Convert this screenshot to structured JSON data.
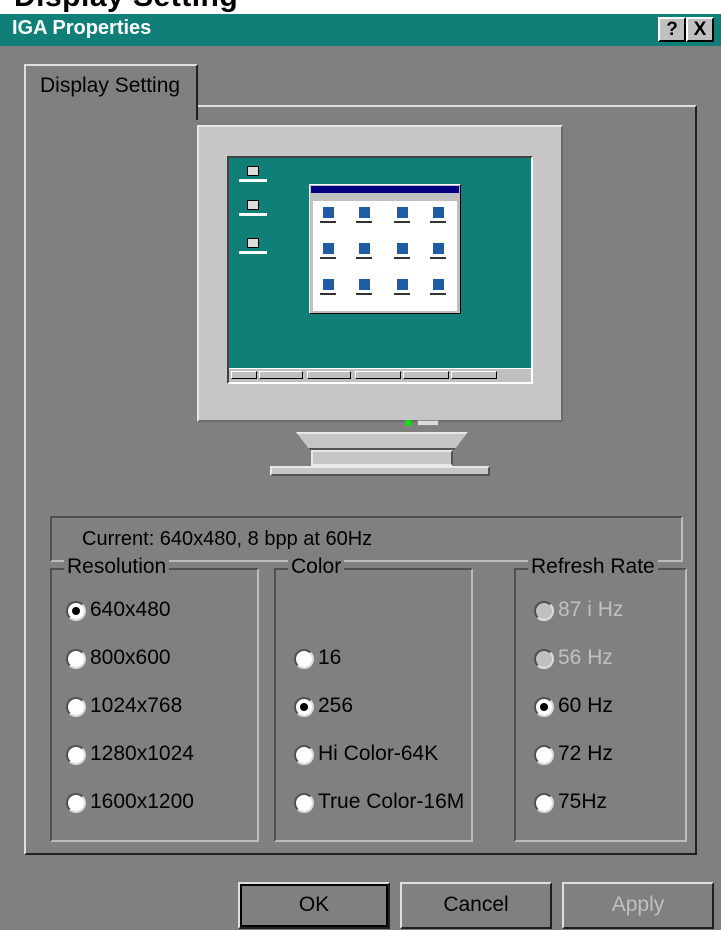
{
  "window": {
    "cropped_heading": "Display Setting",
    "title": "IGA Properties",
    "help_button": "?",
    "close_button": "X"
  },
  "tab": {
    "label": "Display Setting"
  },
  "current": {
    "text": "Current: 640x480, 8 bpp at 60Hz"
  },
  "resolution": {
    "legend": "Resolution",
    "options": [
      "640x480",
      "800x600",
      "1024x768",
      "1280x1024",
      "1600x1200"
    ],
    "selected": "640x480"
  },
  "color": {
    "legend": "Color",
    "options": [
      "16",
      "256",
      "Hi Color-64K",
      "True Color-16M"
    ],
    "selected": "256"
  },
  "refresh": {
    "legend": "Refresh Rate",
    "options": [
      "87 i Hz",
      "56 Hz",
      "60 Hz",
      "72 Hz",
      "75Hz"
    ],
    "disabled": [
      "87 i Hz",
      "56 Hz"
    ],
    "selected": "60 Hz"
  },
  "buttons": {
    "ok": "OK",
    "cancel": "Cancel",
    "apply": "Apply"
  },
  "colors": {
    "titlebar": "#0f7f78",
    "face": "#808080",
    "desktop": "#0f7f78"
  }
}
